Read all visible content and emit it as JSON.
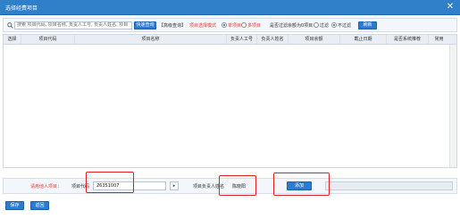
{
  "dialog": {
    "title": "选择经费项目",
    "close_glyph": "✕"
  },
  "toolbar": {
    "search_placeholder": "搜索 项目代码, 项目名称, 负责人工号, 负责人姓名, 项目",
    "quick_query": "快速查询",
    "advanced_query": "【高级查询】",
    "mode_label": "项目选择模式",
    "mode_options": [
      {
        "label": "单项目",
        "selected": true
      },
      {
        "label": "多项目",
        "selected": false
      }
    ],
    "filter_label": "是否过滤余额为0项目",
    "filter_options": [
      {
        "label": "过滤",
        "selected": false
      },
      {
        "label": "不过滤",
        "selected": true
      }
    ],
    "refresh": "刷新"
  },
  "grid": {
    "columns": [
      "选择",
      "项目代码",
      "项目名称",
      "负责人工号",
      "负责人姓名",
      "项目余额",
      "截止日期",
      "是否系统推荐",
      "常用"
    ],
    "rows": []
  },
  "bottom": {
    "hint": "请用他人项目：",
    "code_label": "项目代码",
    "code_value": "26351007",
    "next_glyph": "▸",
    "manager_label": "项目负责人姓名",
    "manager_value": "陈晓阳",
    "add": "添加"
  },
  "footer": {
    "save": "保存",
    "back": "返回"
  },
  "colors": {
    "title_bar": "#2f7fc9",
    "button": "#2d7bd0",
    "accent_red": "#e03c2c",
    "highlight": "#e02020"
  }
}
